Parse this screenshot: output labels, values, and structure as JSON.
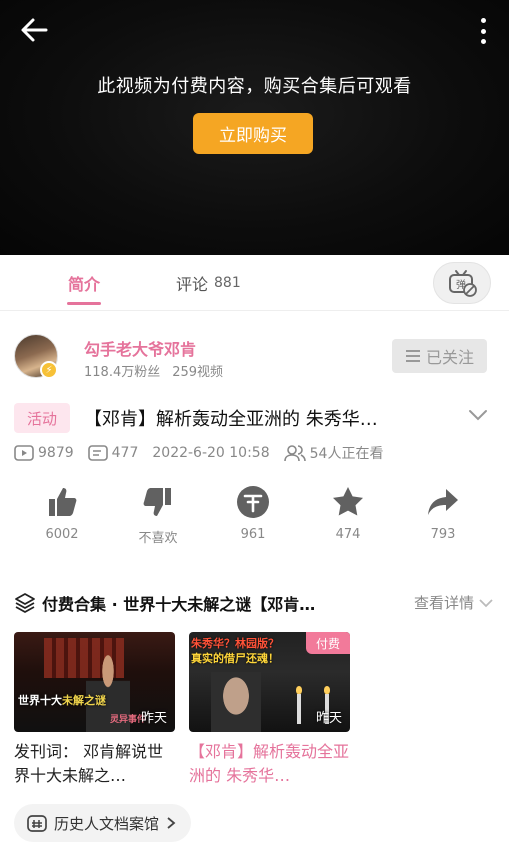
{
  "player": {
    "pay_notice": "此视频为付费内容，购买合集后可观看",
    "buy_label": "立即购买"
  },
  "tabs": {
    "intro": "简介",
    "comments": "评论",
    "comments_count": "881"
  },
  "danmaku_icon_text": "弹",
  "uploader": {
    "name": "勾手老大爷邓肯",
    "fans": "118.4万粉丝",
    "videos": "259视频",
    "follow_label": "已关注"
  },
  "video": {
    "activity_tag": "活动",
    "title": "【邓肯】解析轰动全亚洲的 朱秀华…",
    "plays": "9879",
    "danmaku": "477",
    "date": "2022-6-20 10:58",
    "watching": "54人正在看"
  },
  "actions": [
    {
      "icon": "like-icon",
      "label": "6002"
    },
    {
      "icon": "dislike-icon",
      "label": "不喜欢"
    },
    {
      "icon": "coin-icon",
      "label": "961"
    },
    {
      "icon": "star-icon",
      "label": "474"
    },
    {
      "icon": "share-icon",
      "label": "793"
    }
  ],
  "collection": {
    "title": "付费合集 · 世界十大未解之谜【邓肯…",
    "detail_label": "查看详情",
    "cards": [
      {
        "title": "发刊词： 邓肯解说世界十大未解之…",
        "date": "昨天",
        "thumb_caption": "世界十大未解之谜",
        "thumb_caption_highlight": "未解之谜",
        "thumb_caption_prefix": "世界十大",
        "thumb_caption_right": "灵异事件"
      },
      {
        "title": "【邓肯】解析轰动全亚洲的 朱秀华…",
        "date": "昨天",
        "paid_tag": "付费",
        "thumb_banner_1": "朱秀华？林园版？",
        "thumb_banner_2": "真实的借尸还魂！"
      }
    ]
  },
  "tag_chip": {
    "label": "历史人文档案馆"
  },
  "colors": {
    "pink": "#e5739b",
    "gold": "#f5a623",
    "gray_text": "#888888"
  }
}
